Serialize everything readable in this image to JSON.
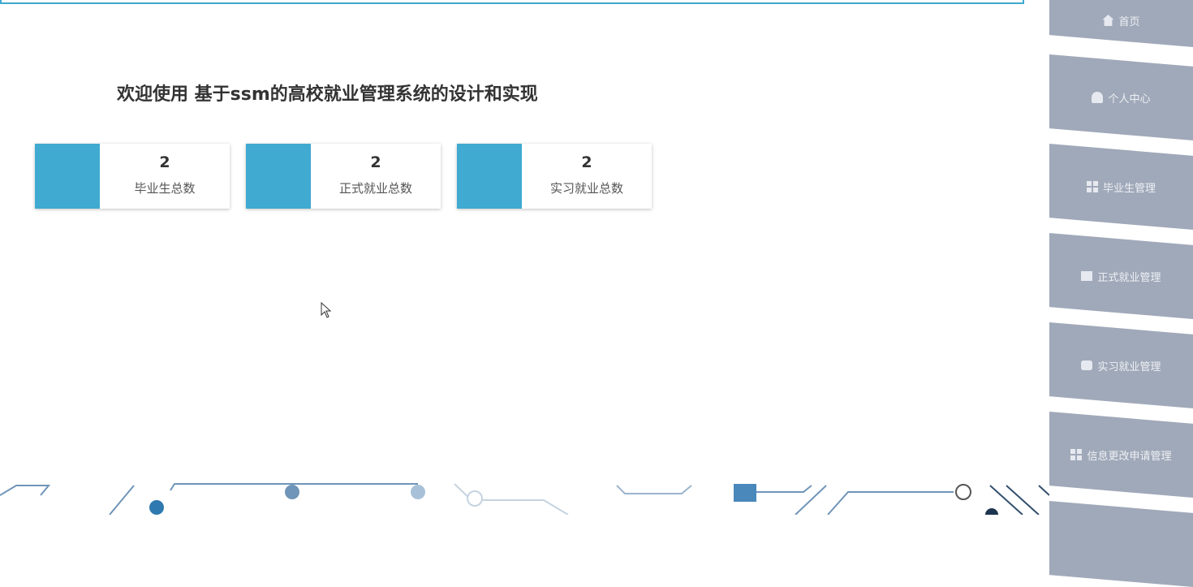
{
  "title": "欢迎使用 基于ssm的高校就业管理系统的设计和实现",
  "stats": [
    {
      "value": "2",
      "label": "毕业生总数"
    },
    {
      "value": "2",
      "label": "正式就业总数"
    },
    {
      "value": "2",
      "label": "实习就业总数"
    }
  ],
  "sidebar": {
    "items": [
      {
        "label": "首页",
        "icon": "home-icon"
      },
      {
        "label": "个人中心",
        "icon": "user-icon"
      },
      {
        "label": "毕业生管理",
        "icon": "grid-icon"
      },
      {
        "label": "正式就业管理",
        "icon": "monitor-icon"
      },
      {
        "label": "实习就业管理",
        "icon": "monitor-icon"
      },
      {
        "label": "信息更改申请管理",
        "icon": "grid-icon"
      }
    ]
  },
  "colors": {
    "accent": "#40aad1",
    "sidebar": "#a0a9b9"
  }
}
